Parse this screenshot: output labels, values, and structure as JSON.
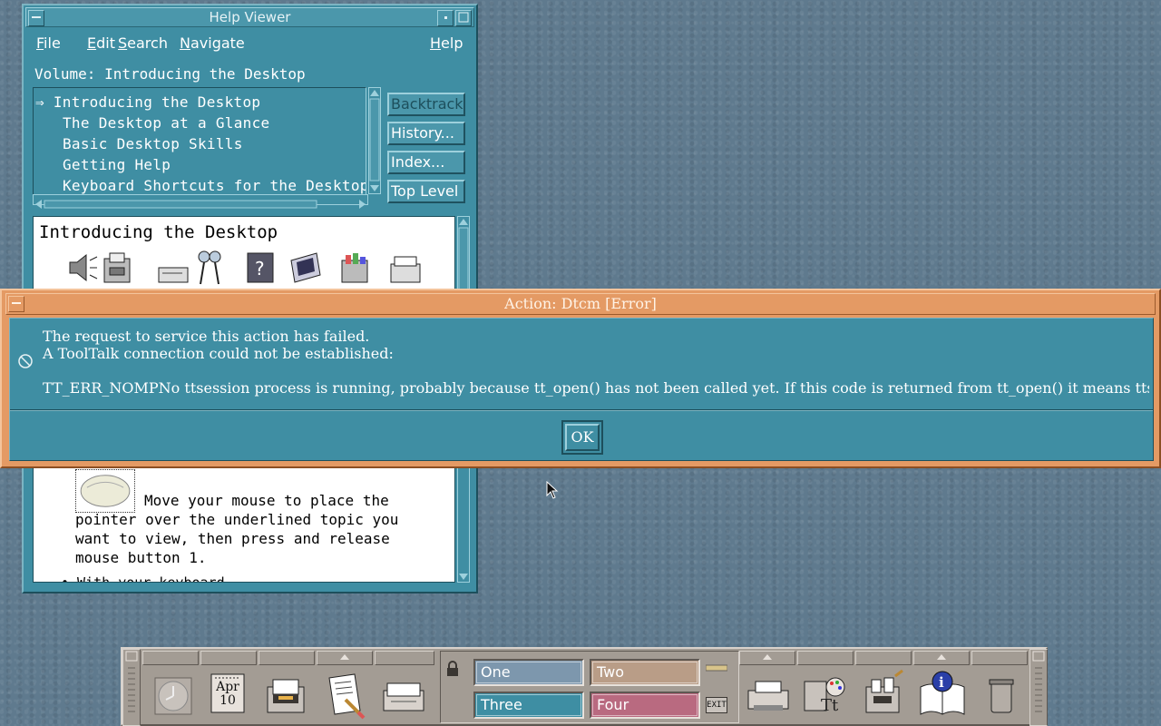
{
  "help_viewer": {
    "title": "Help Viewer",
    "menu": {
      "file": "File",
      "edit": "Edit",
      "search": "Search",
      "navigate": "Navigate",
      "help": "Help"
    },
    "volume": "Volume: Introducing the Desktop",
    "toc": [
      "⇒ Introducing the Desktop",
      "The Desktop at a Glance",
      "Basic Desktop Skills",
      "Getting Help",
      "Keyboard Shortcuts for the Desktop"
    ],
    "buttons": {
      "backtrack": "Backtrack",
      "history": "History...",
      "index": "Index...",
      "top_level": "Top Level"
    },
    "content": {
      "title": "Introducing the Desktop",
      "paragraph_lead": "Move your mouse to place the",
      "paragraph_rest": "pointer over the underlined topic you want to view, then press and release mouse button 1.",
      "more": "• With your keyboard"
    }
  },
  "error_dialog": {
    "title": "Action: Dtcm  [Error]",
    "line1": "The request to service this action has failed.",
    "line2": "A ToolTalk connection could not be established:",
    "detail": "TT_ERR_NOMPNo ttsession process is running, probably because tt_open() has not been called yet. If this code is returned from tt_open() it means ttsession could not be started",
    "ok_label": "OK",
    "icon": "error-circle-icon"
  },
  "front_panel": {
    "calendar": {
      "month": "Apr",
      "day": "10"
    },
    "workspaces": [
      {
        "label": "One",
        "color": "#7d97ad"
      },
      {
        "label": "Two",
        "color": "#b99d87"
      },
      {
        "label": "Three",
        "color": "#3e8ea3"
      },
      {
        "label": "Four",
        "color": "#b96a80"
      }
    ],
    "exit_label": "EXIT"
  }
}
